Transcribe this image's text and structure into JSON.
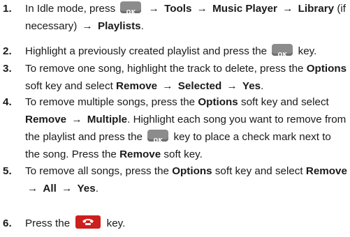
{
  "steps": [
    {
      "num": "1.",
      "t1": "In Idle mode, press",
      "t2": "Tools",
      "t3": "Music Player",
      "t4": "Library",
      "t5": "(if necessary)",
      "t6": "Playlists",
      "t7": "."
    },
    {
      "num": "2.",
      "t1": "Highlight a previously created playlist and press the",
      "t2": "key."
    },
    {
      "num": "3.",
      "t1": "To remove one song, highlight the track to delete, press the",
      "t2": "Options",
      "t3": "soft key and select",
      "t4": "Remove",
      "t5": "Selected",
      "t6": "Yes",
      "t7": "."
    },
    {
      "num": "4.",
      "t1": "To remove multiple songs, press the",
      "t2": "Options",
      "t3": "soft key and select",
      "t4": "Remove",
      "t5": "Multiple",
      "t6": ". Highlight each song you want to remove from the playlist and press the",
      "t7": "key to place a check mark next to the song. Press the",
      "t8": "Remove",
      "t9": "soft key."
    },
    {
      "num": "5.",
      "t1": "To remove all songs, press the",
      "t2": "Options",
      "t3": "soft key and select",
      "t4": "Remove",
      "t5": "All",
      "t6": "Yes",
      "t7": "."
    },
    {
      "num": "6.",
      "t1": "Press the",
      "t2": "key."
    }
  ],
  "keys": {
    "ok_label": "OK",
    "ok_icon": "ok-key-icon",
    "end_icon": "end-key-icon",
    "ok_color": "#8c8c8c",
    "end_color": "#cc1f1f"
  },
  "arrow": "→"
}
